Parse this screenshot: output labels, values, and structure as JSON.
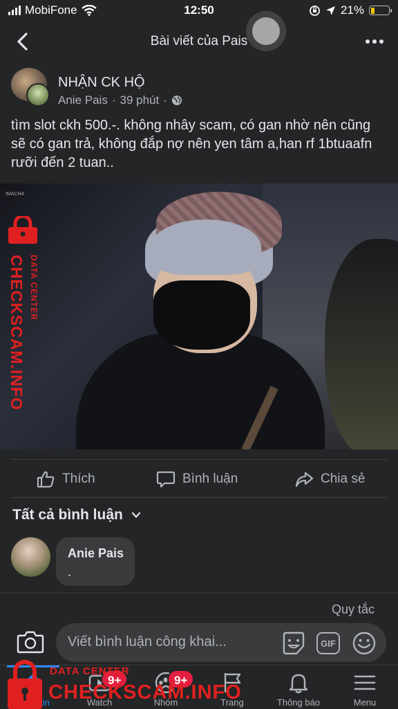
{
  "status_bar": {
    "carrier": "MobiFone",
    "time": "12:50",
    "battery": "21%",
    "battery_level": 0.21
  },
  "nav": {
    "title": "Bài viết của Pais"
  },
  "post": {
    "page_name": "NHẬN CK HỘ",
    "author": "Anie Pais",
    "time_ago": "39 phút",
    "separator": "·",
    "text": "tìm slot ckh 500.-. không nhây scam, có gan nhờ nên cũng sẽ có gan trả, không đắp nợ nên yen tâm a,han rf 1btuaafn rưỡi đến 2 tuan..",
    "photo_tag": "IMACHA"
  },
  "actions": {
    "like": "Thích",
    "comment": "Bình luận",
    "share": "Chia sẻ"
  },
  "comments_filter": "Tất cả bình luận",
  "comments": [
    {
      "name": "Anie Pais",
      "text": "."
    }
  ],
  "composer": {
    "rules": "Quy tắc",
    "placeholder": "Viết bình luận công khai...",
    "gif": "GIF"
  },
  "tabs": [
    {
      "label": "Bảng tin",
      "icon": "home-icon",
      "active": true
    },
    {
      "label": "Watch",
      "icon": "watch-icon",
      "badge": "9+"
    },
    {
      "label": "Nhóm",
      "icon": "groups-icon",
      "badge": "9+"
    },
    {
      "label": "Trang",
      "icon": "pages-flag-icon"
    },
    {
      "label": "Thông báo",
      "icon": "bell-icon"
    },
    {
      "label": "Menu",
      "icon": "menu-icon"
    }
  ],
  "watermark": {
    "small": "DATA CENTER",
    "big": "CHECKSCAM.INFO"
  },
  "colors": {
    "background": "#242526",
    "accent": "#2d88ff",
    "badge": "#e41e3f",
    "watermark": "#e02020"
  }
}
